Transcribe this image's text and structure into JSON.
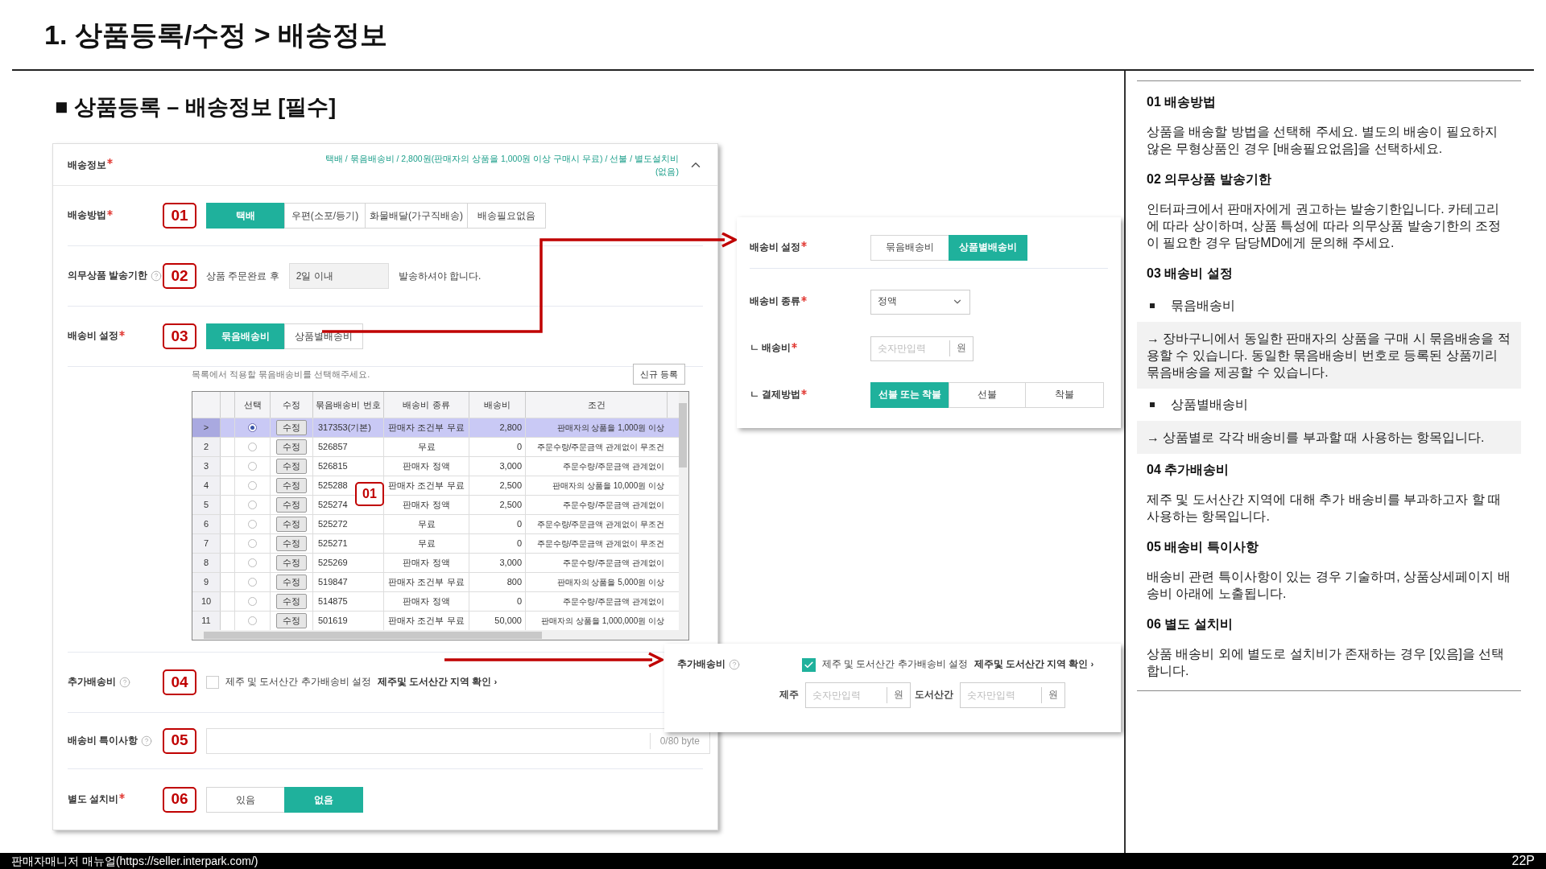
{
  "page_title": "1. 상품등록/수정 > 배송정보",
  "section_title": "■ 상품등록 – 배송정보 [필수]",
  "form": {
    "header": {
      "label": "배송정보",
      "required": true,
      "summary": "택배 / 묶음배송비 / 2,800원(판매자의 상품을 1,000원 이상 구매시 무료) / 선불 / 별도설치비(없음)",
      "expanded": true
    },
    "rows": [
      {
        "kind": "segmented",
        "label": "배송방법",
        "required": true,
        "callout": "01",
        "options": [
          {
            "label": "택배",
            "selected": true
          },
          {
            "label": "우편(소포/등기)",
            "selected": false
          },
          {
            "label": "화물배달(가구직배송)",
            "selected": false
          },
          {
            "label": "배송필요없음",
            "selected": false
          }
        ]
      },
      {
        "kind": "deadline",
        "label": "의무상품 발송기한",
        "help": true,
        "callout": "02",
        "prefix": "상품 주문완료 후",
        "value": "2일 이내",
        "suffix": "발송하셔야 합니다."
      },
      {
        "kind": "segmented",
        "label": "배송비 설정",
        "required": true,
        "callout": "03",
        "options": [
          {
            "label": "묶음배송비",
            "selected": true
          },
          {
            "label": "상품별배송비",
            "selected": false
          }
        ]
      },
      {
        "kind": "bundle_table",
        "hint": "목록에서 적용할 묶음배송비를 선택해주세요.",
        "button": "신규 등록",
        "callout": "01",
        "columns": [
          "선택",
          "수정",
          "묶음배송비 번호",
          "배송비 종류",
          "배송비",
          "조건"
        ],
        "rows": [
          {
            "row_header": ">",
            "selected": true,
            "edit": "수정",
            "number": "317353(기본)",
            "type": "판매자 조건부 무료",
            "fee": "2,800",
            "condition": "판매자의 상품을 1,000원 이상"
          },
          {
            "row_header": "2",
            "selected": false,
            "edit": "수정",
            "number": "526857",
            "type": "무료",
            "fee": "0",
            "condition": "주문수량/주문금액 관계없이 무조건"
          },
          {
            "row_header": "3",
            "selected": false,
            "edit": "수정",
            "number": "526815",
            "type": "판매자 정액",
            "fee": "3,000",
            "condition": "주문수량/주문금액 관계없이"
          },
          {
            "row_header": "4",
            "selected": false,
            "edit": "수정",
            "number": "525288",
            "type": "판매자 조건부 무료",
            "fee": "2,500",
            "condition": "판매자의 상품을 10,000원 이상"
          },
          {
            "row_header": "5",
            "selected": false,
            "edit": "수정",
            "number": "525274",
            "type": "판매자 정액",
            "fee": "2,500",
            "condition": "주문수량/주문금액 관계없이"
          },
          {
            "row_header": "6",
            "selected": false,
            "edit": "수정",
            "number": "525272",
            "type": "무료",
            "fee": "0",
            "condition": "주문수량/주문금액 관계없이 무조건"
          },
          {
            "row_header": "7",
            "selected": false,
            "edit": "수정",
            "number": "525271",
            "type": "무료",
            "fee": "0",
            "condition": "주문수량/주문금액 관계없이 무조건"
          },
          {
            "row_header": "8",
            "selected": false,
            "edit": "수정",
            "number": "525269",
            "type": "판매자 정액",
            "fee": "3,000",
            "condition": "주문수량/주문금액 관계없이"
          },
          {
            "row_header": "9",
            "selected": false,
            "edit": "수정",
            "number": "519847",
            "type": "판매자 조건부 무료",
            "fee": "800",
            "condition": "판매자의 상품을 5,000원 이상"
          },
          {
            "row_header": "10",
            "selected": false,
            "edit": "수정",
            "number": "514875",
            "type": "판매자 정액",
            "fee": "0",
            "condition": "주문수량/주문금액 관계없이"
          },
          {
            "row_header": "11",
            "selected": false,
            "edit": "수정",
            "number": "501619",
            "type": "판매자 조건부 무료",
            "fee": "50,000",
            "condition": "판매자의 상품을 1,000,000원 이상"
          }
        ]
      },
      {
        "kind": "checkbox",
        "label": "추가배송비",
        "help": true,
        "callout": "04",
        "checked": false,
        "text": "제주 및 도서산간 추가배송비 설정",
        "link": "제주및 도서산간 지역 확인 ›"
      },
      {
        "kind": "note",
        "label": "배송비 특이사항",
        "help": true,
        "callout": "05",
        "counter": "0/80 byte"
      },
      {
        "kind": "segmented",
        "label": "별도 설치비",
        "required": true,
        "callout": "06",
        "options": [
          {
            "label": "있음",
            "selected": false
          },
          {
            "label": "없음",
            "selected": true
          }
        ]
      }
    ]
  },
  "fee_popup": {
    "rows": [
      {
        "kind": "segmented",
        "label": "배송비 설정",
        "required": true,
        "options": [
          {
            "label": "묶음배송비",
            "selected": false
          },
          {
            "label": "상품별배송비",
            "selected": true
          }
        ]
      },
      {
        "kind": "select",
        "label": "배송비 종류",
        "required": true,
        "value": "정액"
      },
      {
        "kind": "amount",
        "label": "ㄴ 배송비",
        "required": true,
        "placeholder": "숫자만입력",
        "unit": "원"
      },
      {
        "kind": "segmented",
        "label": "ㄴ 결제방법",
        "required": true,
        "options": [
          {
            "label": "선불 또는 착불",
            "selected": true
          },
          {
            "label": "선불",
            "selected": false
          },
          {
            "label": "착불",
            "selected": false
          }
        ]
      }
    ]
  },
  "extra_popup": {
    "label": "추가배송비",
    "help": true,
    "checked": true,
    "text": "제주 및 도서산간 추가배송비 설정",
    "link": "제주및 도서산간 지역 확인 ›",
    "fields": [
      {
        "label": "제주",
        "placeholder": "숫자만입력",
        "unit": "원"
      },
      {
        "label": "도서산간",
        "placeholder": "숫자만입력",
        "unit": "원"
      }
    ]
  },
  "guide": [
    {
      "title": "01 배송방법",
      "items": [
        {
          "kind": "text",
          "text": "상품을 배송할 방법을 선택해 주세요. 별도의 배송이 필요하지 않은 무형상품인 경우 [배송필요없음]을 선택하세요."
        }
      ]
    },
    {
      "title": "02 의무상품 발송기한",
      "items": [
        {
          "kind": "text",
          "text": "인터파크에서 판매자에게 권고하는 발송기한입니다. 카테고리에 따라 상이하며, 상품 특성에 따라 의무상품 발송기한의 조정이 필요한 경우 담당MD에게 문의해 주세요."
        }
      ]
    },
    {
      "title": "03 배송비 설정",
      "items": [
        {
          "kind": "bullet",
          "text": "묶음배송비"
        },
        {
          "kind": "note",
          "text": "→ 장바구니에서 동일한 판매자의 상품을 구매 시 묶음배송을 적용할 수 있습니다. 동일한 묶음배송비 번호로 등록된 상품끼리 묶음배송을 제공할 수 있습니다."
        },
        {
          "kind": "bullet",
          "text": "상품별배송비"
        },
        {
          "kind": "note",
          "text": "→ 상품별로 각각 배송비를 부과할 때 사용하는 항목입니다."
        }
      ]
    },
    {
      "title": "04 추가배송비",
      "items": [
        {
          "kind": "text",
          "text": "제주 및 도서산간 지역에 대해 추가 배송비를 부과하고자 할 때 사용하는 항목입니다."
        }
      ]
    },
    {
      "title": "05 배송비 특이사항",
      "items": [
        {
          "kind": "text",
          "text": "배송비 관련 특이사항이 있는 경우 기술하며, 상품상세페이지 배송비 아래에 노출됩니다."
        }
      ]
    },
    {
      "title": "06 별도 설치비",
      "items": [
        {
          "kind": "text",
          "text": "상품 배송비 외에 별도로 설치비가 존재하는 경우 [있음]을 선택합니다."
        }
      ]
    }
  ],
  "footer": {
    "source": "판매자매니저 매뉴얼(https://seller.interpark.com/)",
    "page": "22P"
  }
}
